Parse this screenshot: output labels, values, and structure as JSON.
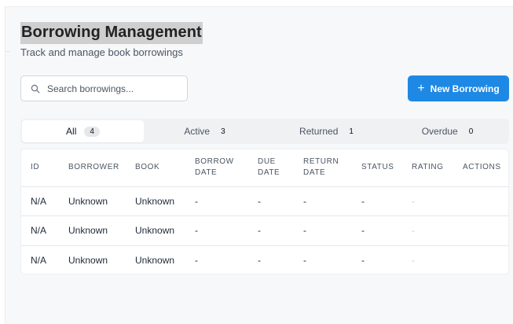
{
  "header": {
    "title": "Borrowing Management",
    "subtitle": "Track and manage book borrowings"
  },
  "search": {
    "placeholder": "Search borrowings...",
    "value": ""
  },
  "actions": {
    "new_borrowing_label": "New Borrowing",
    "new_borrowing_icon": "plus-icon"
  },
  "tabs": [
    {
      "label": "All",
      "count": "4",
      "active": true
    },
    {
      "label": "Active",
      "count": "3",
      "active": false
    },
    {
      "label": "Returned",
      "count": "1",
      "active": false
    },
    {
      "label": "Overdue",
      "count": "0",
      "active": false
    }
  ],
  "table": {
    "columns": [
      {
        "line1": "ID",
        "line2": ""
      },
      {
        "line1": "BORROWER",
        "line2": ""
      },
      {
        "line1": "BOOK",
        "line2": ""
      },
      {
        "line1": "BORROW",
        "line2": "DATE"
      },
      {
        "line1": "DUE",
        "line2": "DATE"
      },
      {
        "line1": "RETURN",
        "line2": "DATE"
      },
      {
        "line1": "STATUS",
        "line2": ""
      },
      {
        "line1": "RATING",
        "line2": ""
      },
      {
        "line1": "ACTIONS",
        "line2": ""
      }
    ],
    "rows": [
      {
        "id": "N/A",
        "borrower": "Unknown",
        "book": "Unknown",
        "borrow_date": "-",
        "due_date": "-",
        "return_date": "-",
        "status": "-",
        "rating": "-",
        "actions": ""
      },
      {
        "id": "N/A",
        "borrower": "Unknown",
        "book": "Unknown",
        "borrow_date": "-",
        "due_date": "-",
        "return_date": "-",
        "status": "-",
        "rating": "-",
        "actions": ""
      },
      {
        "id": "N/A",
        "borrower": "Unknown",
        "book": "Unknown",
        "borrow_date": "-",
        "due_date": "-",
        "return_date": "-",
        "status": "-",
        "rating": "-",
        "actions": ""
      }
    ]
  },
  "colors": {
    "primary": "#1e88e5",
    "page_bg": "#f7f8fa",
    "title_highlight": "#cfcfcf"
  }
}
